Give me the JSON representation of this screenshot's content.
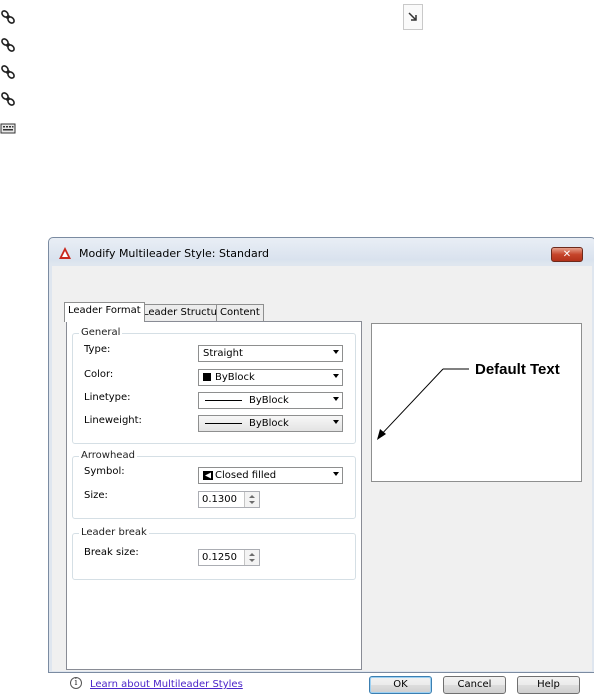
{
  "toolbar_icons": [
    "chain-link-icon",
    "chain-link-icon",
    "chain-link-icon",
    "chain-link-icon",
    "keyboard-icon"
  ],
  "corner_icon": "diagonal-arrow-icon",
  "dialog": {
    "title": "Modify Multileader Style: Standard",
    "close_symbol": "✕",
    "tabs": [
      "Leader Format",
      "Leader Structure",
      "Content"
    ],
    "active_tab": "Leader Format",
    "general": {
      "title": "General",
      "type_label": "Type:",
      "type_value": "Straight",
      "color_label": "Color:",
      "color_value": "ByBlock",
      "linetype_label": "Linetype:",
      "linetype_value": "ByBlock",
      "lineweight_label": "Lineweight:",
      "lineweight_value": "ByBlock"
    },
    "arrowhead": {
      "title": "Arrowhead",
      "symbol_label": "Symbol:",
      "symbol_value": "Closed filled",
      "size_label": "Size:",
      "size_value": "0.1300"
    },
    "leader_break": {
      "title": "Leader break",
      "break_size_label": "Break size:",
      "break_size_value": "0.1250"
    },
    "preview": {
      "text": "Default Text"
    },
    "help_link": "Learn about Multileader Styles",
    "buttons": {
      "ok": "OK",
      "cancel": "Cancel",
      "help": "Help"
    }
  }
}
